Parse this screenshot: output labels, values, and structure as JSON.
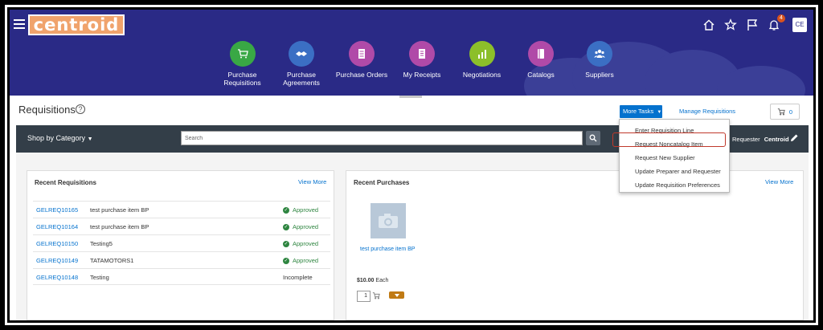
{
  "header": {
    "logo_text": "centroid",
    "avatar": "CE",
    "notification_count": "4",
    "nav": [
      {
        "label": "Purchase\nRequisitions",
        "color": "#39a845",
        "icon": "cart-icon"
      },
      {
        "label": "Purchase\nAgreements",
        "color": "#3b6fc4",
        "icon": "handshake-icon"
      },
      {
        "label": "Purchase Orders",
        "color": "#b04aa8",
        "icon": "document-icon"
      },
      {
        "label": "My Receipts",
        "color": "#b04aa8",
        "icon": "receipt-icon"
      },
      {
        "label": "Negotiations",
        "color": "#8cbf2a",
        "icon": "chart-icon"
      },
      {
        "label": "Catalogs",
        "color": "#b04aa8",
        "icon": "book-icon"
      },
      {
        "label": "Suppliers",
        "color": "#3b6fc4",
        "icon": "people-icon"
      }
    ]
  },
  "page": {
    "title": "Requisitions",
    "more_tasks": "More Tasks",
    "manage_requisitions": "Manage Requisitions",
    "cart_count": "0"
  },
  "searchbar": {
    "shop_by_category": "Shop by Category",
    "search_placeholder": "Search",
    "requester_label": "Requester",
    "requester_value": "Centroid"
  },
  "dropdown": {
    "items": [
      "Enter Requisition Line",
      "Request Noncatalog Item",
      "Request New Supplier",
      "Update Preparer and Requester",
      "Update Requisition Preferences"
    ]
  },
  "recent_requisitions": {
    "title": "Recent Requisitions",
    "view_more": "View More",
    "rows": [
      {
        "id": "GELREQ10165",
        "description": "test purchase item BP",
        "status": "Approved"
      },
      {
        "id": "GELREQ10164",
        "description": "test purchase item BP",
        "status": "Approved"
      },
      {
        "id": "GELREQ10150",
        "description": "Testing5",
        "status": "Approved"
      },
      {
        "id": "GELREQ10149",
        "description": "TATAMOTORS1",
        "status": "Approved"
      },
      {
        "id": "GELREQ10148",
        "description": "Testing",
        "status": "Incomplete"
      }
    ]
  },
  "recent_purchases": {
    "title": "Recent Purchases",
    "view_more": "View More",
    "item": {
      "name": "test purchase item BP",
      "price": "$10.00",
      "unit": "Each",
      "quantity": "1"
    }
  }
}
